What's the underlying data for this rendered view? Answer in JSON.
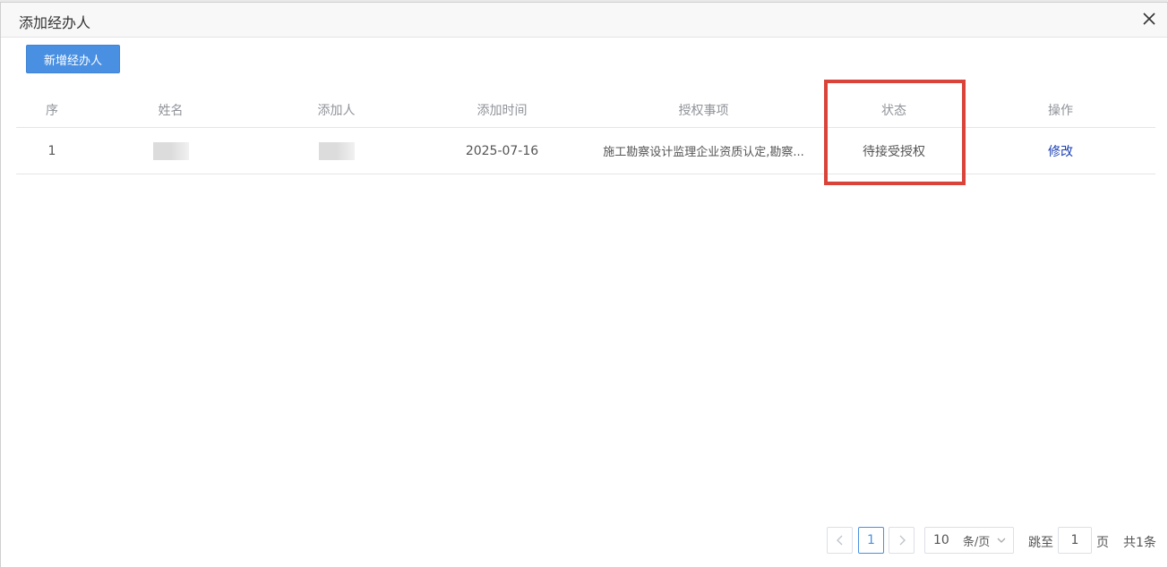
{
  "dialog": {
    "title": "添加经办人",
    "add_button_label": "新增经办人"
  },
  "table": {
    "headers": [
      "序",
      "姓名",
      "添加人",
      "添加时间",
      "授权事项",
      "状态",
      "操作"
    ],
    "rows": [
      {
        "index": "1",
        "name": "",
        "added_by": "",
        "added_time": "2025-07-16",
        "authorized_items": "施工勘察设计监理企业资质认定,勘察...",
        "status": "待接受授权",
        "action": "修改"
      }
    ]
  },
  "pagination": {
    "current_page": "1",
    "page_size": "10",
    "page_size_unit": "条/页",
    "jump_label": "跳至",
    "jump_value": "1",
    "page_unit": "页",
    "total_text": "共1条"
  },
  "colors": {
    "primary": "#4a90e2",
    "link": "#1a3fb5",
    "highlight_border": "#d9433a"
  },
  "icons": {
    "close": "close-icon",
    "prev": "chevron-left-icon",
    "next": "chevron-right-icon",
    "dropdown": "chevron-down-icon"
  }
}
